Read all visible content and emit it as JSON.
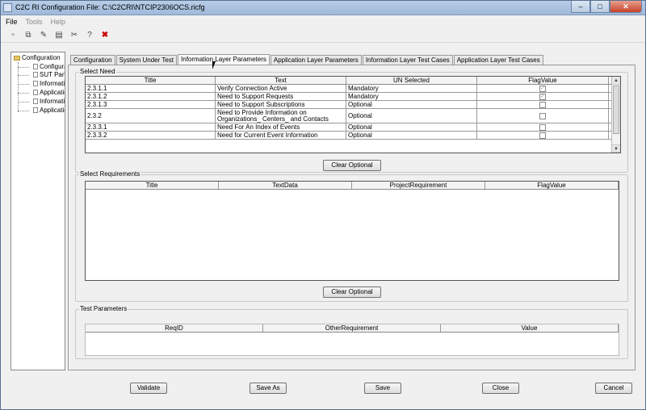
{
  "window": {
    "title": "C2C RI  Configuration File: C:\\C2CRI\\NTCIP2306OCS.ricfg",
    "minimize": "–",
    "maximize": "□",
    "close": "✕"
  },
  "menu": {
    "file": "File",
    "tools": "Tools",
    "help": "Help"
  },
  "toolbar": {
    "icons": [
      "new-icon",
      "open-icon",
      "edit-icon",
      "page-icon",
      "settings-icon",
      "help-icon",
      "delete-icon"
    ],
    "glyphs": [
      "▫",
      "⧉",
      "✎",
      "▤",
      "✂",
      "?",
      "✖"
    ]
  },
  "tree": {
    "root": "Configuration",
    "children": [
      "Configuratio",
      "SUT Panel",
      "Information",
      "Application I",
      "Information",
      "Application I"
    ]
  },
  "tabs": [
    "Configuration",
    "System Under Test",
    "Information Layer Parameters",
    "Application Layer Parameters",
    "Information Layer Test Cases",
    "Application Layer Test Cases"
  ],
  "select_need": {
    "label": "Select Need",
    "columns": [
      "Title",
      "Text",
      "UN Selected",
      "FlagValue"
    ],
    "rows": [
      {
        "title": "2.3.1.1",
        "text": "Verify Connection Active",
        "selected": "Mandatory",
        "flag": "✓"
      },
      {
        "title": "2.3.1.2",
        "text": "Need to Support Requests",
        "selected": "Mandatory",
        "flag": "✓"
      },
      {
        "title": "2.3.1.3",
        "text": "Need to Support Subscriptions",
        "selected": "Optional",
        "flag": ""
      },
      {
        "title": "2.3.2",
        "text": "Need to Provide Information on Organizations_ Centers_ and Contacts",
        "selected": "Optional",
        "flag": ""
      },
      {
        "title": "2.3.3.1",
        "text": "Need For An Index of Events",
        "selected": "Optional",
        "flag": ""
      },
      {
        "title": "2.3.3.2",
        "text": "Need for Current Event Information",
        "selected": "Optional",
        "flag": ""
      }
    ],
    "clear_button": "Clear Optional"
  },
  "select_requirements": {
    "label": "Select Requirements",
    "columns": [
      "Title",
      "TextData",
      "ProjectRequirement",
      "FlagValue"
    ],
    "clear_button": "Clear Optional"
  },
  "test_parameters": {
    "label": "Test Parameters",
    "columns": [
      "ReqID",
      "OtherRequirement",
      "Value"
    ]
  },
  "buttons": {
    "validate": "Validate",
    "save_as": "Save As",
    "save": "Save",
    "close": "Close",
    "cancel": "Cancel"
  }
}
